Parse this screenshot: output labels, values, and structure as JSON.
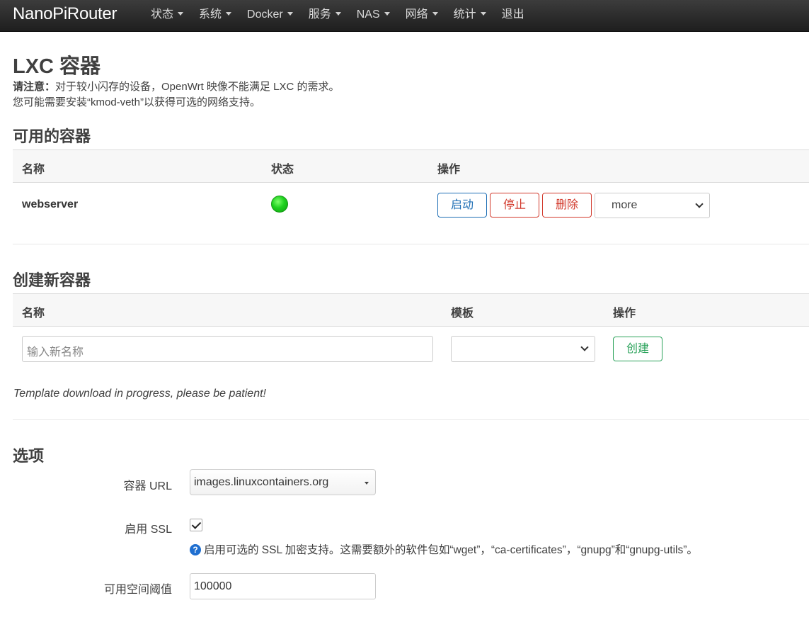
{
  "nav": {
    "brand": "NanoPiRouter",
    "items": [
      {
        "label": "状态",
        "dropdown": true
      },
      {
        "label": "系统",
        "dropdown": true
      },
      {
        "label": "Docker",
        "dropdown": true
      },
      {
        "label": "服务",
        "dropdown": true
      },
      {
        "label": "NAS",
        "dropdown": true
      },
      {
        "label": "网络",
        "dropdown": true
      },
      {
        "label": "统计",
        "dropdown": true
      },
      {
        "label": "退出",
        "dropdown": false
      }
    ]
  },
  "page": {
    "title": "LXC 容器",
    "notice_bold": "请注意：",
    "notice_line1": "对于较小闪存的设备，OpenWrt 映像不能满足 LXC 的需求。",
    "notice_line2": "您可能需要安装“kmod-veth”以获得可选的网络支持。"
  },
  "available": {
    "title": "可用的容器",
    "headers": {
      "name": "名称",
      "status": "状态",
      "actions": "操作"
    },
    "rows": [
      {
        "name": "webserver",
        "status": "running",
        "status_color": "#22cc22",
        "start_label": "启动",
        "stop_label": "停止",
        "delete_label": "删除",
        "more_label": "more"
      }
    ]
  },
  "create": {
    "title": "创建新容器",
    "headers": {
      "name": "名称",
      "template": "模板",
      "actions": "操作"
    },
    "name_placeholder": "输入新名称",
    "template_value": "",
    "create_label": "创建",
    "progress_note": "Template download in progress, please be patient!"
  },
  "options": {
    "title": "选项",
    "url_label": "容器 URL",
    "url_value": "images.linuxcontainers.org",
    "ssl_label": "启用 SSL",
    "ssl_checked": true,
    "ssl_help": "启用可选的 SSL 加密支持。这需要额外的软件包如“wget”，“ca-certificates”，“gnupg”和“gnupg-utils”。",
    "threshold_label": "可用空间阈值",
    "threshold_value": "100000"
  },
  "colors": {
    "accent_blue": "#1f6fb5",
    "danger_red": "#d23a2d",
    "success_green": "#2aa25a"
  }
}
